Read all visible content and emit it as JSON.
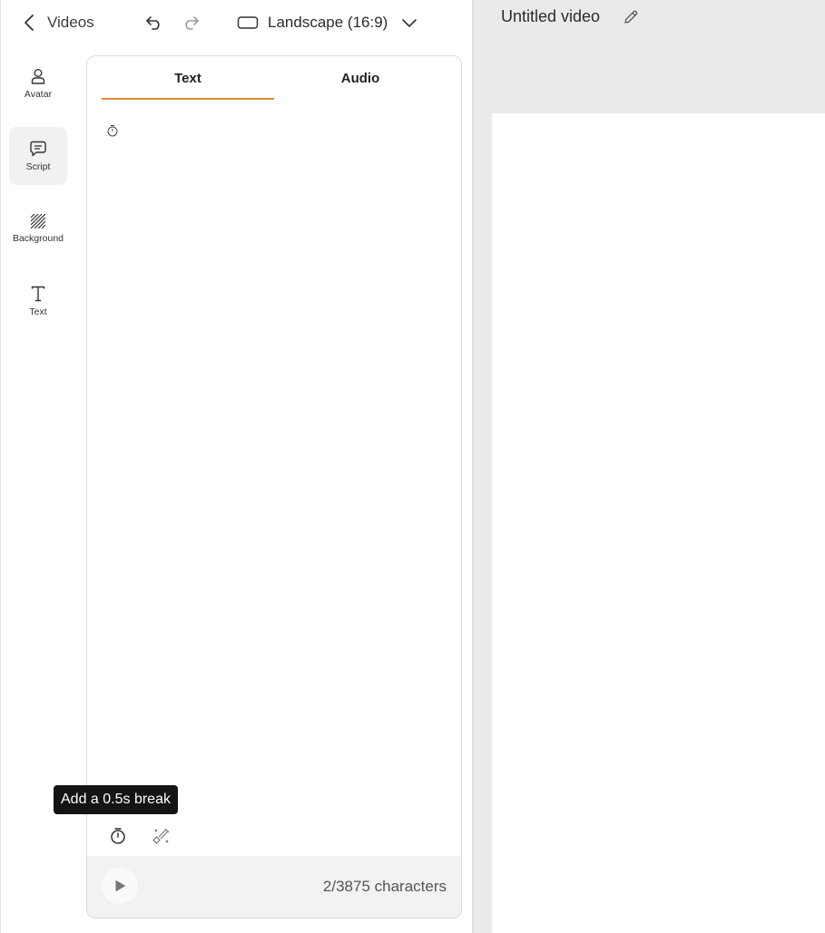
{
  "topbar": {
    "back_label": "Videos",
    "aspect_label": "Landscape (16:9)"
  },
  "sidebar": {
    "items": [
      {
        "label": "Avatar",
        "icon": "person-icon"
      },
      {
        "label": "Script",
        "icon": "chat-icon",
        "active": true
      },
      {
        "label": "Background",
        "icon": "hatch-icon"
      },
      {
        "label": "Text",
        "icon": "text-icon"
      }
    ]
  },
  "script_panel": {
    "tabs": [
      {
        "label": "Text",
        "active": true
      },
      {
        "label": "Audio",
        "active": false
      }
    ],
    "tooltip": "Add a 0.5s break",
    "char_count": "2/3875 characters"
  },
  "preview": {
    "title": "Untitled video"
  },
  "colors": {
    "accent": "#e08a3c",
    "panel_footer": "#f2f2f2",
    "preview_bg": "#eaeaea",
    "tooltip_bg": "#141414"
  }
}
